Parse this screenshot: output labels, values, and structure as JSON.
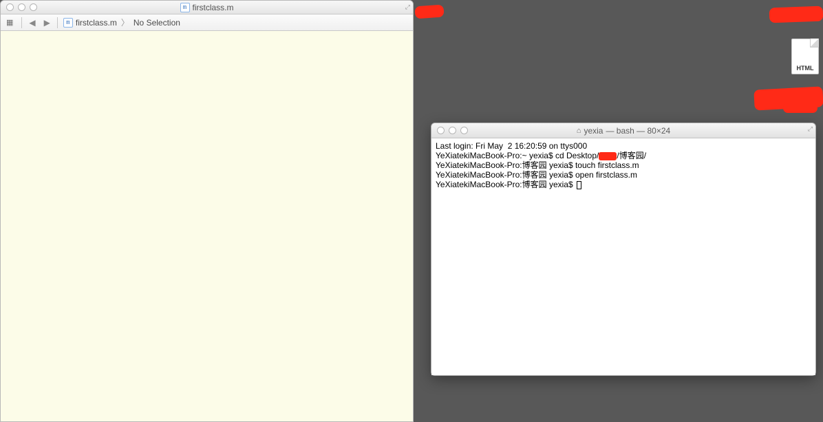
{
  "editor": {
    "title": "firstclass.m",
    "jumpbar": {
      "file": "firstclass.m",
      "selection": "No Selection"
    }
  },
  "terminal": {
    "title_user": "yexia",
    "title_rest": " — bash — 80×24",
    "lines": {
      "l0": "Last login: Fri May  2 16:20:59 on ttys000",
      "l1a": "YeXiatekiMacBook-Pro:~ yexia$ cd Desktop/",
      "l1b": "/博客园/",
      "l2": "YeXiatekiMacBook-Pro:博客园 yexia$ touch firstclass.m",
      "l3": "YeXiatekiMacBook-Pro:博客园 yexia$ open firstclass.m",
      "l4": "YeXiatekiMacBook-Pro:博客园 yexia$ "
    }
  },
  "desktop": {
    "html_label": "HTML"
  }
}
